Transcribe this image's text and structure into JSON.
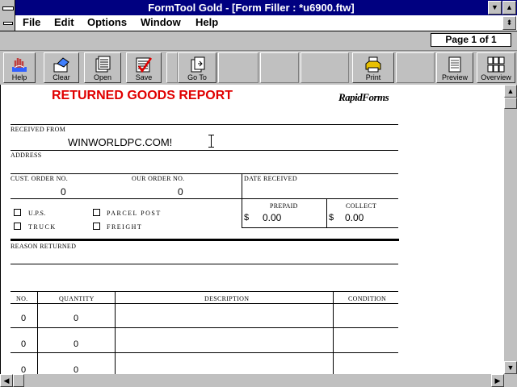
{
  "window": {
    "title": "FormTool Gold - [Form Filler : *u6900.ftw]"
  },
  "menu": [
    "File",
    "Edit",
    "Options",
    "Window",
    "Help"
  ],
  "page_indicator": "Page 1 of 1",
  "toolbar": {
    "help": "Help",
    "clear": "Clear",
    "open": "Open",
    "save": "Save",
    "goto": "Go To",
    "print": "Print",
    "preview": "Preview",
    "overview": "Overview"
  },
  "form": {
    "title": "RETURNED GOODS REPORT",
    "brand": "RapidForms",
    "received_from_label": "RECEIVED FROM",
    "received_from_value": "WINWORLDPC.COM!",
    "address_label": "ADDRESS",
    "cust_order_label": "CUST. ORDER NO.",
    "cust_order_value": "0",
    "our_order_label": "OUR ORDER NO.",
    "our_order_value": "0",
    "date_received_label": "DATE RECEIVED",
    "ship": {
      "ups": "U.P.S.",
      "truck": "TRUCK",
      "parcel": "PARCEL POST",
      "freight": "FREIGHT"
    },
    "prepaid_label": "PREPAID",
    "collect_label": "COLLECT",
    "currency": "$",
    "prepaid_value": "0.00",
    "collect_value": "0.00",
    "reason_label": "REASON RETURNED",
    "table_headers": {
      "no": "NO.",
      "quantity": "QUANTITY",
      "description": "DESCRIPTION",
      "condition": "CONDITION"
    },
    "rows": [
      {
        "no": "0",
        "qty": "0"
      },
      {
        "no": "0",
        "qty": "0"
      },
      {
        "no": "0",
        "qty": "0"
      }
    ]
  }
}
